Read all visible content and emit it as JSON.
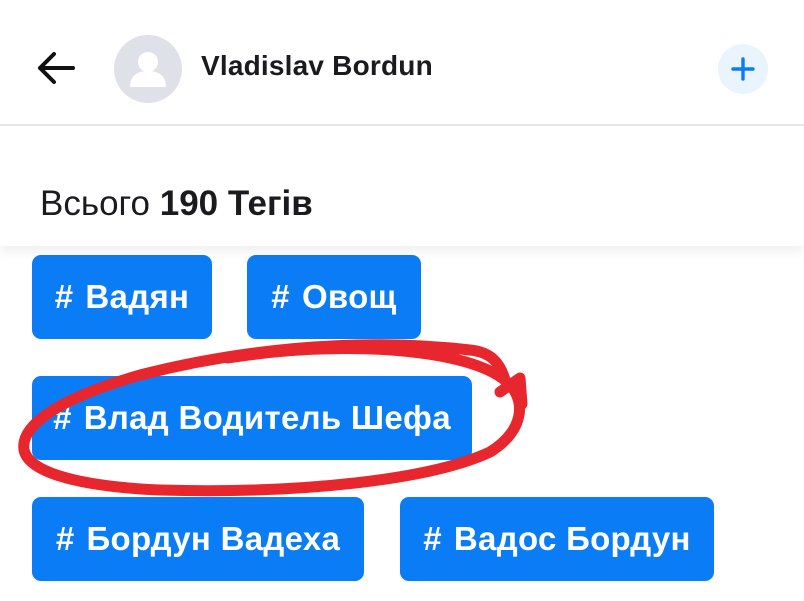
{
  "header": {
    "back_icon": "arrow-left-icon",
    "avatar_icon": "user-silhouette-icon",
    "user_name": "Vladislav Bordun",
    "add_icon": "plus-icon",
    "accent_color": "#0a7cf5"
  },
  "summary": {
    "prefix": "Всього",
    "count_label": "190 Тегів"
  },
  "tags": [
    {
      "hash": "#",
      "label": "Вадян"
    },
    {
      "hash": "#",
      "label": "Овощ"
    },
    {
      "hash": "#",
      "label": "Влад Водитель Шефа"
    },
    {
      "hash": "#",
      "label": "Бордун Вадеха"
    },
    {
      "hash": "#",
      "label": "Вадос Бордун"
    }
  ],
  "annotation": {
    "shape": "hand-drawn-ellipse",
    "color": "#e8262d",
    "encircled_tag_index": 2
  }
}
